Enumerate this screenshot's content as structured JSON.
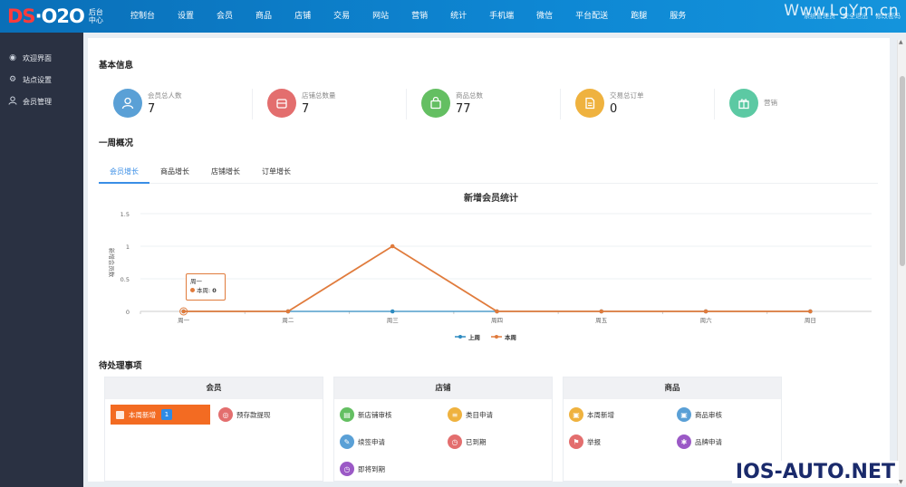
{
  "header": {
    "logo_mark_ds": "DS",
    "logo_mark_rest": "·O2O",
    "logo_sub": "后台中心",
    "nav": [
      "控制台",
      "设置",
      "会员",
      "商品",
      "店铺",
      "交易",
      "网站",
      "营销",
      "统计",
      "手机端",
      "微信",
      "平台配送",
      "跑腿",
      "服务"
    ],
    "right_links": [
      "系统管理员",
      "安全退出",
      "修改密码"
    ]
  },
  "sidebar": {
    "items": [
      {
        "label": "欢迎界面",
        "icon": "eye-icon"
      },
      {
        "label": "站点设置",
        "icon": "gear-icon"
      },
      {
        "label": "会员管理",
        "icon": "user-icon"
      }
    ]
  },
  "basic": {
    "title": "基本信息",
    "stats": [
      {
        "label": "会员总人数",
        "value": "7",
        "color": "#5aa0d6",
        "icon": "user-icon"
      },
      {
        "label": "店铺总数量",
        "value": "7",
        "color": "#e36e6e",
        "icon": "store-icon"
      },
      {
        "label": "商品总数",
        "value": "77",
        "color": "#64bf62",
        "icon": "bag-icon"
      },
      {
        "label": "交易总订单",
        "value": "0",
        "color": "#efb23f",
        "icon": "order-icon"
      },
      {
        "label": "营销",
        "value": "",
        "color": "#5cc9a3",
        "icon": "gift-icon"
      }
    ]
  },
  "week": {
    "title": "一周概况",
    "tabs": [
      "会员增长",
      "商品增长",
      "店铺增长",
      "订单增长"
    ]
  },
  "chart_data": {
    "type": "line",
    "title": "新增会员统计",
    "ylabel": "新增会员数",
    "categories": [
      "周一",
      "周二",
      "周三",
      "周四",
      "周五",
      "周六",
      "周日"
    ],
    "yticks": [
      "0",
      "0.5",
      "1",
      "1.5"
    ],
    "ylim": [
      0,
      1.5
    ],
    "series": [
      {
        "name": "上周",
        "color": "#2e8bc0",
        "values": [
          0,
          0,
          0,
          0,
          0,
          0,
          0
        ]
      },
      {
        "name": "本周",
        "color": "#e07b3c",
        "values": [
          0,
          0,
          1,
          0,
          0,
          0,
          0
        ]
      }
    ],
    "tooltip": {
      "title": "周一",
      "series": "本周",
      "value": "0"
    },
    "legend_position": "bottom"
  },
  "pending": {
    "title": "待处理事项",
    "cards": [
      {
        "title": "会员",
        "items": [
          {
            "label": "本周新增",
            "badge": "1",
            "color": "#f36b22",
            "icon": "user-icon"
          },
          {
            "label": "预存款提现",
            "color": "#e36e6e",
            "icon": "coin-icon"
          }
        ]
      },
      {
        "title": "店铺",
        "items": [
          {
            "label": "新店铺审核",
            "color": "#64bf62",
            "icon": "store-icon"
          },
          {
            "label": "类目申请",
            "color": "#efb23f",
            "icon": "list-icon"
          },
          {
            "label": "续签申请",
            "color": "#5aa0d6",
            "icon": "pen-icon"
          },
          {
            "label": "已到期",
            "color": "#e36e6e",
            "icon": "clock-icon"
          },
          {
            "label": "即将到期",
            "color": "#9b59c6",
            "icon": "clock-icon"
          }
        ]
      },
      {
        "title": "商品",
        "items": [
          {
            "label": "本周新增",
            "color": "#efb23f",
            "icon": "bag-icon"
          },
          {
            "label": "商品审核",
            "color": "#5aa0d6",
            "icon": "bag-icon"
          },
          {
            "label": "举报",
            "color": "#e36e6e",
            "icon": "flag-icon"
          },
          {
            "label": "品牌申请",
            "color": "#9b59c6",
            "icon": "star-icon"
          }
        ]
      }
    ]
  },
  "watermarks": {
    "top": "Www.LgYm.cn",
    "bottom": "IOS-AUTO.NET"
  }
}
